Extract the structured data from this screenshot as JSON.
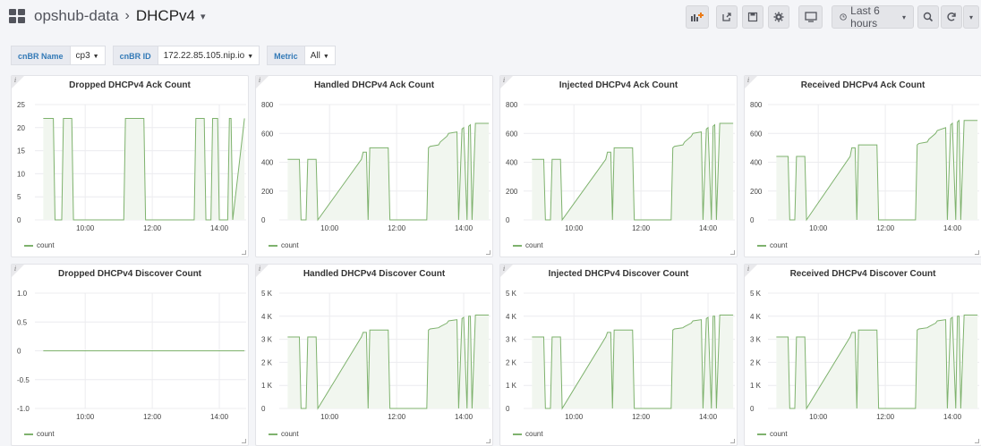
{
  "header": {
    "folder": "opshub-data",
    "dashboard": "DHCPv4",
    "time_picker_label": "Last 6 hours"
  },
  "variables": [
    {
      "label": "cnBR Name",
      "value": "cp3"
    },
    {
      "label": "cnBR ID",
      "value": "172.22.85.105.nip.io"
    },
    {
      "label": "Metric",
      "value": "All"
    }
  ],
  "icons": {
    "add_panel": "add-panel-icon",
    "share": "share-icon",
    "save": "save-icon",
    "settings": "gear-icon",
    "tv": "monitor-icon",
    "clock": "clock-icon",
    "zoom": "zoom-out-icon",
    "refresh": "refresh-icon",
    "more": "chevron-down-icon"
  },
  "colors": {
    "series": "#7eb26d",
    "fill": "#f1f6ef",
    "variable_label": "#337ab7"
  },
  "chart_data": [
    {
      "type": "line",
      "title": "Dropped DHCPv4 Ack Count",
      "ylim": [
        0,
        25
      ],
      "yticks": [
        "0",
        "5",
        "10",
        "15",
        "20",
        "25"
      ],
      "xticks": [
        "10:00",
        "12:00",
        "14:00"
      ],
      "legend": "count",
      "series": [
        {
          "name": "count",
          "x": [
            8.75,
            9.05,
            9.1,
            9.3,
            9.35,
            9.6,
            9.65,
            11.15,
            11.2,
            11.75,
            11.8,
            13.25,
            13.3,
            13.55,
            13.6,
            13.75,
            13.8,
            13.95,
            14.0,
            14.25,
            14.3,
            14.35,
            14.4,
            14.75
          ],
          "y": [
            22,
            22,
            0,
            0,
            22,
            22,
            0,
            0,
            22,
            22,
            0,
            0,
            22,
            22,
            0,
            0,
            22,
            22,
            0,
            0,
            22,
            22,
            0,
            22
          ]
        }
      ]
    },
    {
      "type": "line",
      "title": "Handled DHCPv4 Ack Count",
      "ylim": [
        0,
        800
      ],
      "yticks": [
        "0",
        "200",
        "400",
        "600",
        "800"
      ],
      "xticks": [
        "10:00",
        "12:00",
        "14:00"
      ],
      "legend": "count",
      "series": [
        {
          "name": "count",
          "x": [
            8.75,
            9.1,
            9.15,
            9.3,
            9.35,
            9.6,
            9.65,
            10.95,
            11.0,
            11.1,
            11.15,
            11.2,
            11.75,
            11.8,
            12.9,
            12.95,
            13.0,
            13.25,
            13.3,
            13.5,
            13.55,
            13.8,
            13.85,
            13.95,
            14.0,
            14.1,
            14.15,
            14.2,
            14.25,
            14.35,
            14.4,
            14.75
          ],
          "y": [
            420,
            420,
            0,
            0,
            420,
            420,
            0,
            420,
            470,
            470,
            0,
            500,
            500,
            0,
            0,
            500,
            510,
            520,
            540,
            580,
            600,
            610,
            0,
            630,
            640,
            0,
            650,
            660,
            0,
            670,
            670,
            670
          ]
        }
      ]
    },
    {
      "type": "line",
      "title": "Injected DHCPv4 Ack Count",
      "ylim": [
        0,
        800
      ],
      "yticks": [
        "0",
        "200",
        "400",
        "600",
        "800"
      ],
      "xticks": [
        "10:00",
        "12:00",
        "14:00"
      ],
      "legend": "count",
      "series": [
        {
          "name": "count",
          "x": [
            8.75,
            9.1,
            9.15,
            9.3,
            9.35,
            9.6,
            9.65,
            10.95,
            11.0,
            11.1,
            11.15,
            11.2,
            11.75,
            11.8,
            12.9,
            12.95,
            13.0,
            13.25,
            13.3,
            13.5,
            13.55,
            13.8,
            13.85,
            13.95,
            14.0,
            14.1,
            14.15,
            14.2,
            14.25,
            14.35,
            14.4,
            14.75
          ],
          "y": [
            420,
            420,
            0,
            0,
            420,
            420,
            0,
            420,
            470,
            470,
            0,
            500,
            500,
            0,
            0,
            500,
            510,
            520,
            540,
            580,
            600,
            610,
            0,
            630,
            640,
            0,
            650,
            660,
            0,
            670,
            670,
            670
          ]
        }
      ]
    },
    {
      "type": "line",
      "title": "Received DHCPv4 Ack Count",
      "ylim": [
        0,
        800
      ],
      "yticks": [
        "0",
        "200",
        "400",
        "600",
        "800"
      ],
      "xticks": [
        "10:00",
        "12:00",
        "14:00"
      ],
      "legend": "count",
      "series": [
        {
          "name": "count",
          "x": [
            8.75,
            9.1,
            9.15,
            9.3,
            9.35,
            9.6,
            9.65,
            10.95,
            11.0,
            11.1,
            11.15,
            11.2,
            11.75,
            11.8,
            12.9,
            12.95,
            13.0,
            13.25,
            13.3,
            13.5,
            13.55,
            13.8,
            13.85,
            13.95,
            14.0,
            14.1,
            14.15,
            14.2,
            14.25,
            14.35,
            14.4,
            14.75
          ],
          "y": [
            440,
            440,
            0,
            0,
            440,
            440,
            0,
            440,
            500,
            500,
            0,
            520,
            520,
            0,
            0,
            520,
            530,
            540,
            560,
            600,
            620,
            640,
            0,
            660,
            670,
            0,
            680,
            690,
            0,
            690,
            690,
            690
          ]
        }
      ]
    },
    {
      "type": "line",
      "title": "Dropped DHCPv4 Discover Count",
      "ylim": [
        -1,
        1
      ],
      "yticks": [
        "-1.0",
        "-0.5",
        "0",
        "0.5",
        "1.0"
      ],
      "xticks": [
        "10:00",
        "12:00",
        "14:00"
      ],
      "legend": "count",
      "series": [
        {
          "name": "count",
          "x": [
            8.75,
            14.75
          ],
          "y": [
            0,
            0
          ]
        }
      ]
    },
    {
      "type": "line",
      "title": "Handled DHCPv4 Discover Count",
      "ylim": [
        0,
        5000
      ],
      "yticks": [
        "0",
        "1 K",
        "2 K",
        "3 K",
        "4 K",
        "5 K"
      ],
      "xticks": [
        "10:00",
        "12:00",
        "14:00"
      ],
      "legend": "count",
      "series": [
        {
          "name": "count",
          "x": [
            8.75,
            9.1,
            9.15,
            9.3,
            9.35,
            9.6,
            9.65,
            10.95,
            11.0,
            11.1,
            11.15,
            11.2,
            11.75,
            11.8,
            12.9,
            12.95,
            13.0,
            13.25,
            13.3,
            13.5,
            13.55,
            13.8,
            13.85,
            13.95,
            14.0,
            14.1,
            14.15,
            14.2,
            14.25,
            14.35,
            14.4,
            14.75
          ],
          "y": [
            3100,
            3100,
            0,
            0,
            3100,
            3100,
            0,
            3100,
            3300,
            3300,
            0,
            3400,
            3400,
            0,
            0,
            3400,
            3450,
            3500,
            3550,
            3700,
            3800,
            3850,
            0,
            3900,
            3950,
            0,
            4000,
            4000,
            0,
            4050,
            4050,
            4050
          ]
        }
      ]
    },
    {
      "type": "line",
      "title": "Injected DHCPv4 Discover Count",
      "ylim": [
        0,
        5000
      ],
      "yticks": [
        "0",
        "1 K",
        "2 K",
        "3 K",
        "4 K",
        "5 K"
      ],
      "xticks": [
        "10:00",
        "12:00",
        "14:00"
      ],
      "legend": "count",
      "series": [
        {
          "name": "count",
          "x": [
            8.75,
            9.1,
            9.15,
            9.3,
            9.35,
            9.6,
            9.65,
            10.95,
            11.0,
            11.1,
            11.15,
            11.2,
            11.75,
            11.8,
            12.9,
            12.95,
            13.0,
            13.25,
            13.3,
            13.5,
            13.55,
            13.8,
            13.85,
            13.95,
            14.0,
            14.1,
            14.15,
            14.2,
            14.25,
            14.35,
            14.4,
            14.75
          ],
          "y": [
            3100,
            3100,
            0,
            0,
            3100,
            3100,
            0,
            3100,
            3300,
            3300,
            0,
            3400,
            3400,
            0,
            0,
            3400,
            3450,
            3500,
            3550,
            3700,
            3800,
            3850,
            0,
            3900,
            3950,
            0,
            4000,
            4000,
            0,
            4050,
            4050,
            4050
          ]
        }
      ]
    },
    {
      "type": "line",
      "title": "Received DHCPv4 Discover Count",
      "ylim": [
        0,
        5000
      ],
      "yticks": [
        "0",
        "1 K",
        "2 K",
        "3 K",
        "4 K",
        "5 K"
      ],
      "xticks": [
        "10:00",
        "12:00",
        "14:00"
      ],
      "legend": "count",
      "series": [
        {
          "name": "count",
          "x": [
            8.75,
            9.1,
            9.15,
            9.3,
            9.35,
            9.6,
            9.65,
            10.95,
            11.0,
            11.1,
            11.15,
            11.2,
            11.75,
            11.8,
            12.9,
            12.95,
            13.0,
            13.25,
            13.3,
            13.5,
            13.55,
            13.8,
            13.85,
            13.95,
            14.0,
            14.1,
            14.15,
            14.2,
            14.25,
            14.35,
            14.4,
            14.75
          ],
          "y": [
            3100,
            3100,
            0,
            0,
            3100,
            3100,
            0,
            3100,
            3300,
            3300,
            0,
            3400,
            3400,
            0,
            0,
            3400,
            3450,
            3500,
            3550,
            3700,
            3800,
            3850,
            0,
            3900,
            3950,
            0,
            4000,
            4000,
            0,
            4050,
            4050,
            4050
          ]
        }
      ]
    }
  ]
}
